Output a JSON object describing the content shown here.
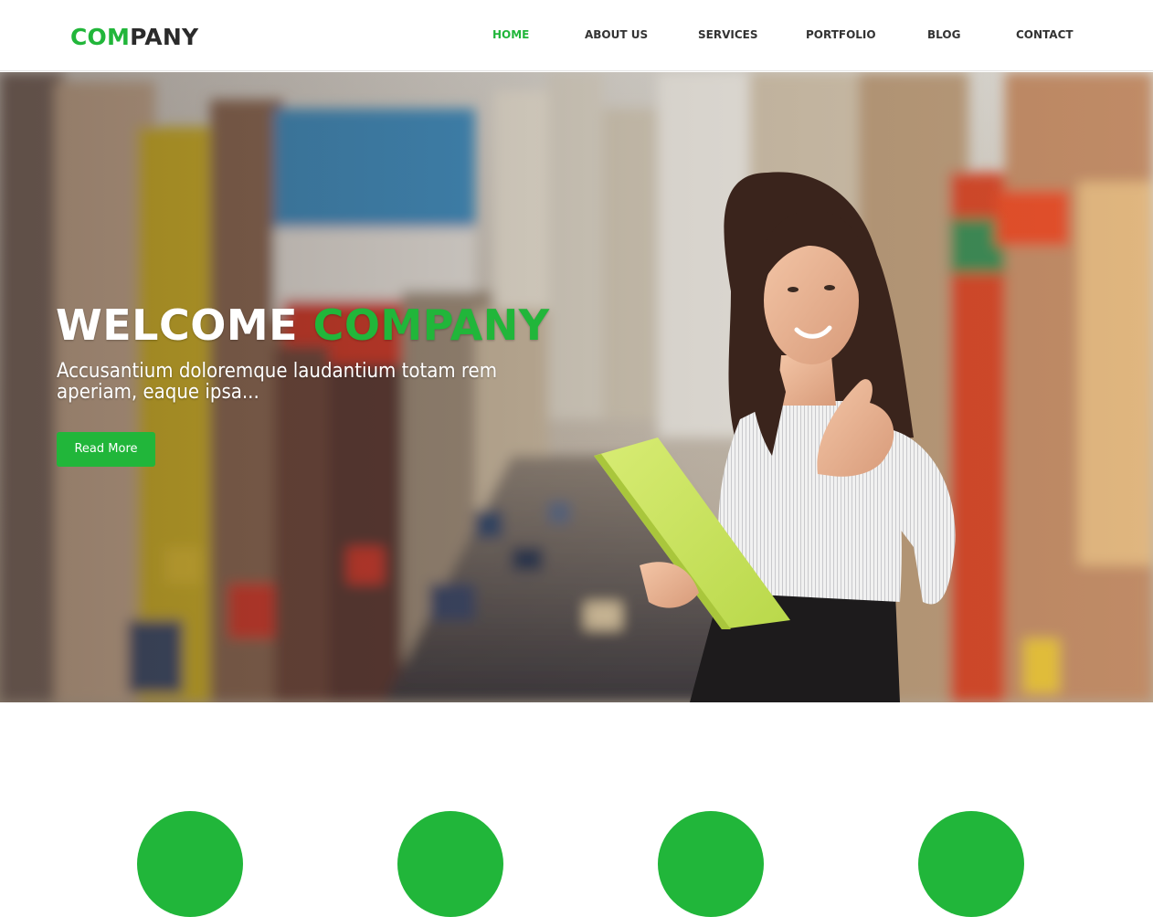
{
  "brand": {
    "logo_part1": "COM",
    "logo_part2": "PANY"
  },
  "nav": {
    "items": [
      {
        "label": "HOME",
        "active": true
      },
      {
        "label": "ABOUT US",
        "active": false
      },
      {
        "label": "SERVICES",
        "active": false
      },
      {
        "label": "PORTFOLIO",
        "active": false
      },
      {
        "label": "BLOG",
        "active": false
      },
      {
        "label": "CONTACT",
        "active": false
      }
    ]
  },
  "hero": {
    "title_part1": "WELCOME",
    "title_part2": "COMPANY",
    "subtitle": "Accusantium doloremque laudantium totam rem aperiam, eaque ipsa...",
    "button_label": "Read More"
  },
  "colors": {
    "accent": "#21b63a",
    "text_dark": "#333333",
    "white": "#ffffff"
  },
  "features": {
    "circle_count": 4
  }
}
